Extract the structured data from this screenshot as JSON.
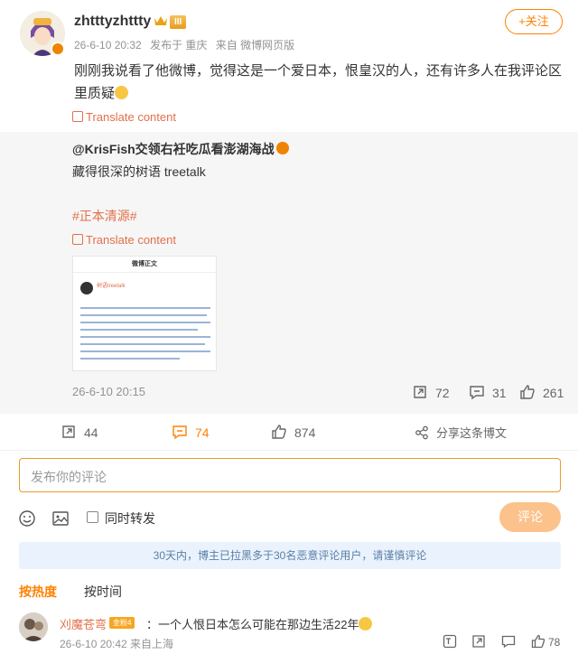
{
  "post": {
    "username": "zhtttyzhttty",
    "vip_level": "III",
    "time": "26-6-10 20:32",
    "location": "发布于 重庆",
    "source": "来自 微博网页版",
    "follow_label": "+关注",
    "text": "刚刚我说看了他微博，觉得这是一个爱日本，恨皇汉的人，还有许多人在我评论区里质疑",
    "translate_label": "Translate content"
  },
  "repost": {
    "author": "@KrisFish交领右衽吃瓜看澎湖海战",
    "text": "藏得很深的树语 treetalk",
    "tag": "#正本清源#",
    "translate_label": "Translate content",
    "thumb_title": "微博正文",
    "thumb_author": "树语treetalk",
    "time": "26-6-10 20:15",
    "reposts": "72",
    "comments": "31",
    "likes": "261"
  },
  "actions": {
    "reposts": "44",
    "comments": "74",
    "likes": "874",
    "share_label": "分享这条博文"
  },
  "composer": {
    "placeholder": "发布你的评论",
    "repost_label": "同时转发",
    "submit_label": "评论"
  },
  "notice": "30天内，博主已拉黑多于30名恶意评论用户，请谨慎评论",
  "sort": {
    "hot_label": "按热度",
    "time_label": "按时间"
  },
  "comment": {
    "name": "刈魔苍弯",
    "badge": "金粉4",
    "text": "：一个人恨日本怎么可能在那边生活22年",
    "meta": "26-6-10 20:42 来自上海",
    "likes": "78"
  },
  "colors": {
    "accent": "#ff8200",
    "link": "#e2704a",
    "notice_bg": "#eaf3fd"
  }
}
